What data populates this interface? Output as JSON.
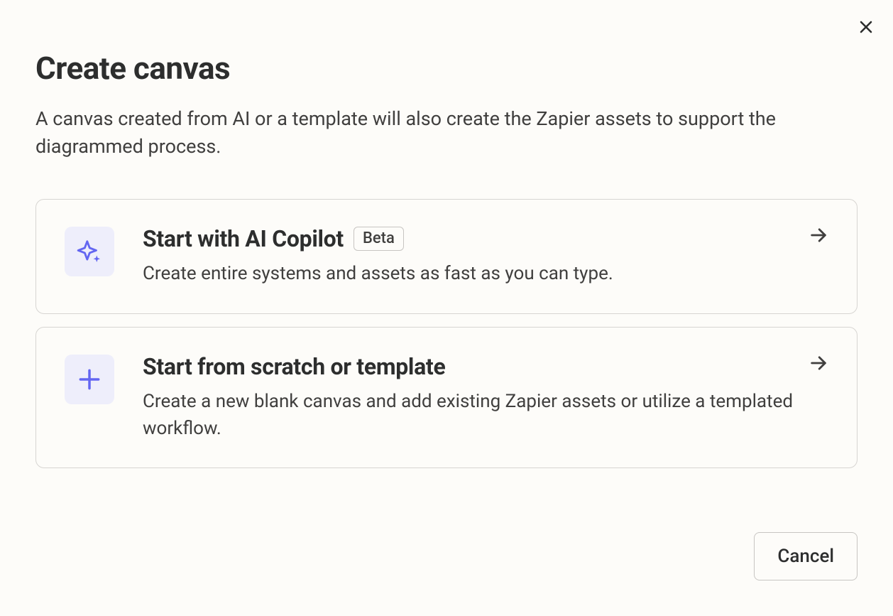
{
  "dialog": {
    "title": "Create canvas",
    "subtitle": "A canvas created from AI or a template will also create the Zapier assets to support the diagrammed process."
  },
  "options": [
    {
      "title": "Start with AI Copilot",
      "badge": "Beta",
      "description": "Create entire systems and assets as fast as you can type."
    },
    {
      "title": "Start from scratch or template",
      "badge": null,
      "description": "Create a new blank canvas and add existing Zapier assets or utilize a templated workflow."
    }
  ],
  "footer": {
    "cancel": "Cancel"
  }
}
